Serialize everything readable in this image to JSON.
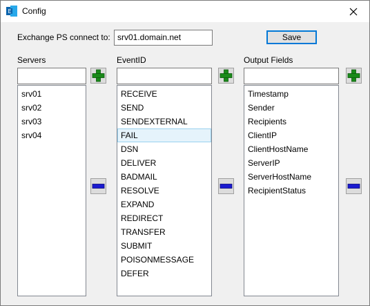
{
  "window": {
    "title": "Config",
    "close_glyph": "✕"
  },
  "connect": {
    "label": "Exchange PS connect to:",
    "value": "srv01.domain.net"
  },
  "save_label": "Save",
  "servers": {
    "label": "Servers",
    "filter_value": "",
    "items": [
      "srv01",
      "srv02",
      "srv03",
      "srv04"
    ]
  },
  "eventid": {
    "label": "EventID",
    "filter_value": "",
    "items": [
      "RECEIVE",
      "SEND",
      "SENDEXTERNAL",
      "FAIL",
      "DSN",
      "DELIVER",
      "BADMAIL",
      "RESOLVE",
      "EXPAND",
      "REDIRECT",
      "TRANSFER",
      "SUBMIT",
      "POISONMESSAGE",
      "DEFER"
    ],
    "selected": "FAIL"
  },
  "output_fields": {
    "label": "Output Fields",
    "filter_value": "",
    "items": [
      "Timestamp",
      "Sender",
      "Recipients",
      "ClientIP",
      "ClientHostName",
      "ServerIP",
      "ServerHostName",
      "RecipientStatus"
    ]
  },
  "colors": {
    "add_green": "#1a8a1a",
    "remove_blue": "#1a1ad0",
    "selection_bg": "#e5f3fb",
    "selection_border": "#99d1ef",
    "accent": "#0078d7"
  },
  "icons": {
    "add": "plus-icon",
    "remove": "minus-icon",
    "app": "exchange-icon"
  }
}
